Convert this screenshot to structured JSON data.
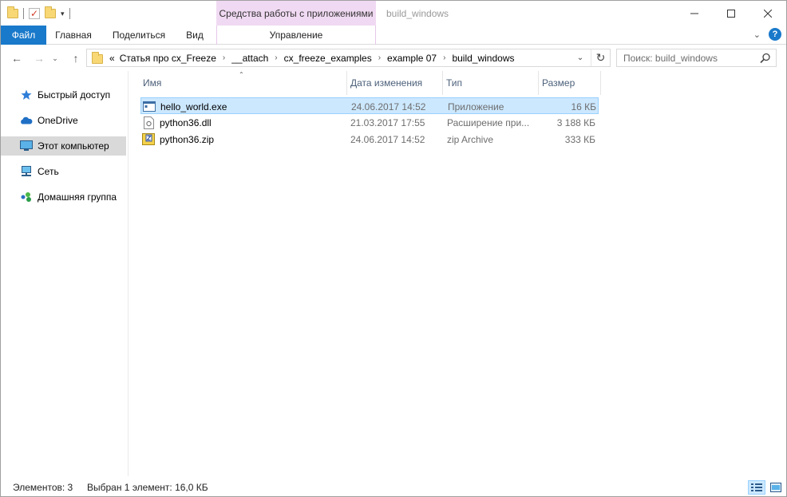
{
  "window": {
    "title": "build_windows",
    "context_tab_group": "Средства работы с приложениями"
  },
  "ribbon": {
    "tabs": [
      "Файл",
      "Главная",
      "Поделиться",
      "Вид"
    ],
    "context_tab": "Управление"
  },
  "address": {
    "overflow": "«",
    "crumbs": [
      "Статья про cx_Freeze",
      "__attach",
      "cx_freeze_examples",
      "example 07",
      "build_windows"
    ]
  },
  "search": {
    "placeholder": "Поиск: build_windows"
  },
  "nav": {
    "items": [
      {
        "label": "Быстрый доступ",
        "icon": "star-icon"
      },
      {
        "label": "OneDrive",
        "icon": "cloud-icon"
      },
      {
        "label": "Этот компьютер",
        "icon": "computer-icon",
        "selected": true
      },
      {
        "label": "Сеть",
        "icon": "network-icon"
      },
      {
        "label": "Домашняя группа",
        "icon": "homegroup-icon"
      }
    ]
  },
  "columns": {
    "name": "Имя",
    "date": "Дата изменения",
    "type": "Тип",
    "size": "Размер"
  },
  "files": [
    {
      "name": "hello_world.exe",
      "date": "24.06.2017 14:52",
      "type": "Приложение",
      "size": "16 КБ",
      "icon": "exe-icon",
      "selected": true
    },
    {
      "name": "python36.dll",
      "date": "21.03.2017 17:55",
      "type": "Расширение при...",
      "size": "3 188 КБ",
      "icon": "dll-icon"
    },
    {
      "name": "python36.zip",
      "date": "24.06.2017 14:52",
      "type": "zip Archive",
      "size": "333 КБ",
      "icon": "zip-icon"
    }
  ],
  "status": {
    "count": "Элементов: 3",
    "selection": "Выбран 1 элемент: 16,0 КБ"
  },
  "colors": {
    "accent": "#1979ca",
    "context_tab": "#f0d9f2",
    "selection": "#cce8ff"
  }
}
